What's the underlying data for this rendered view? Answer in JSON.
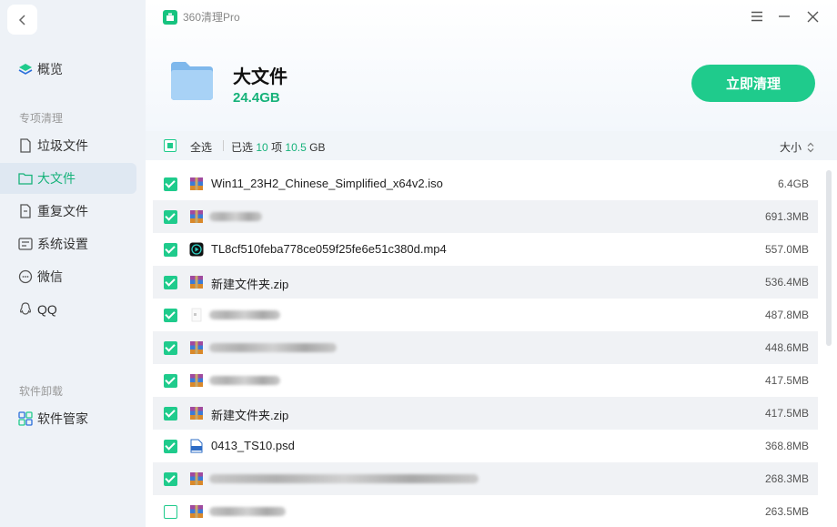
{
  "app": {
    "title": "360清理Pro"
  },
  "sidebar": {
    "overview": "概览",
    "section_special": "专项清理",
    "items": [
      {
        "label": "垃圾文件",
        "icon": "file-icon"
      },
      {
        "label": "大文件",
        "icon": "folder-icon"
      },
      {
        "label": "重复文件",
        "icon": "duplicate-file-icon"
      },
      {
        "label": "系统设置",
        "icon": "settings-panel-icon"
      },
      {
        "label": "微信",
        "icon": "chat-icon"
      },
      {
        "label": "QQ",
        "icon": "qq-icon"
      }
    ],
    "section_uninstall": "软件卸载",
    "software_manager": "软件管家"
  },
  "header": {
    "title": "大文件",
    "size": "24.4GB",
    "clean_button": "立即清理"
  },
  "toolbar": {
    "select_all": "全选",
    "selected_prefix": "已选",
    "selected_count": "10",
    "count_unit": "项",
    "selected_size": "10.5",
    "size_unit": "GB",
    "sort_label": "大小"
  },
  "files": [
    {
      "name": "Win11_23H2_Chinese_Simplified_x64v2.iso",
      "size": "6.4GB",
      "checked": true,
      "icon": "archive-icon"
    },
    {
      "name": "",
      "size": "691.3MB",
      "checked": true,
      "icon": "archive-icon"
    },
    {
      "name": "TL8cf510feba778ce059f25fe6e51c380d.mp4",
      "size": "557.0MB",
      "checked": true,
      "icon": "video-icon"
    },
    {
      "name": "新建文件夹.zip",
      "size": "536.4MB",
      "checked": true,
      "icon": "archive-icon"
    },
    {
      "name": "",
      "size": "487.8MB",
      "checked": true,
      "icon": "blank-file-icon"
    },
    {
      "name": "",
      "size": "448.6MB",
      "checked": true,
      "icon": "archive-icon"
    },
    {
      "name": "",
      "size": "417.5MB",
      "checked": true,
      "icon": "archive-icon"
    },
    {
      "name": "新建文件夹.zip",
      "size": "417.5MB",
      "checked": true,
      "icon": "archive-icon"
    },
    {
      "name": "0413_TS10.psd",
      "size": "368.8MB",
      "checked": true,
      "icon": "psd-icon"
    },
    {
      "name": "",
      "size": "268.3MB",
      "checked": true,
      "icon": "archive-icon"
    },
    {
      "name": "",
      "size": "263.5MB",
      "checked": false,
      "icon": "archive-icon"
    }
  ],
  "colors": {
    "accent": "#1fcb8c",
    "accent_text": "#16b27a",
    "sidebar_bg": "#eef2f7"
  }
}
